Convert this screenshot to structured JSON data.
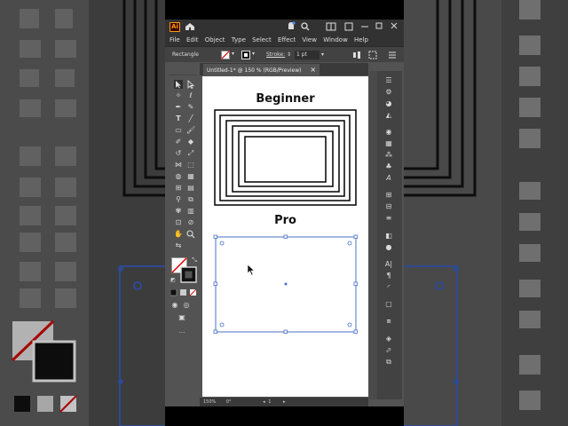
{
  "window": {
    "app_logo": "Ai",
    "menu": [
      "File",
      "Edit",
      "Object",
      "Type",
      "Select",
      "Effect",
      "View",
      "Window",
      "Help"
    ]
  },
  "control_bar": {
    "selection_type": "Rectangle",
    "stroke_label": "Stroke:",
    "stroke_value": "1 pt"
  },
  "document_tab": {
    "title": "Untitled-1* @ 150 % (RGB/Preview)",
    "close": "×"
  },
  "artboard": {
    "heading_top": "Beginner",
    "heading_bottom": "Pro"
  },
  "status_bar": {
    "zoom": "150%",
    "rotation": "0°",
    "artboard_number": "1"
  },
  "colors": {
    "app_bg": "#535353",
    "panel_dark": "#323232",
    "selection_blue": "#4a6fc7",
    "logo_orange": "#ff9a00"
  }
}
